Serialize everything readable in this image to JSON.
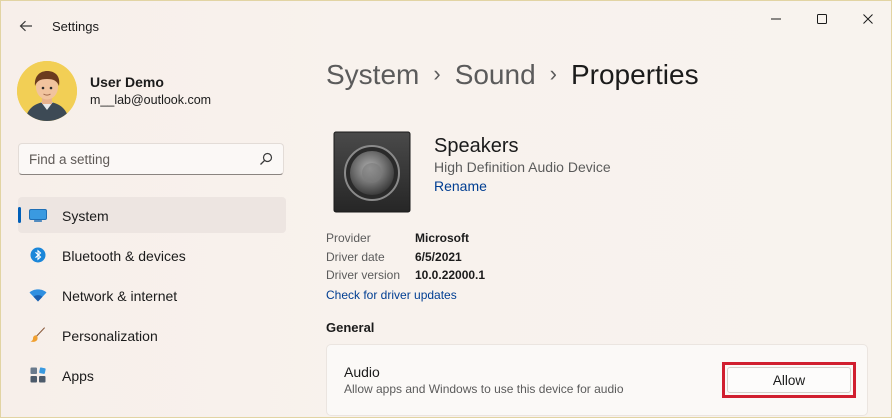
{
  "app": {
    "title": "Settings"
  },
  "user": {
    "name": "User Demo",
    "email": "m__lab@outlook.com"
  },
  "search": {
    "placeholder": "Find a setting",
    "icon": "search-icon"
  },
  "nav": {
    "items": [
      {
        "label": "System",
        "icon": "system-icon",
        "active": true
      },
      {
        "label": "Bluetooth & devices",
        "icon": "bluetooth-icon"
      },
      {
        "label": "Network & internet",
        "icon": "wifi-icon"
      },
      {
        "label": "Personalization",
        "icon": "brush-icon"
      },
      {
        "label": "Apps",
        "icon": "apps-icon"
      }
    ]
  },
  "breadcrumb": {
    "items": [
      "System",
      "Sound",
      "Properties"
    ]
  },
  "device": {
    "name": "Speakers",
    "subtitle": "High Definition Audio Device",
    "rename_label": "Rename",
    "properties": [
      {
        "key": "Provider",
        "value": "Microsoft"
      },
      {
        "key": "Driver date",
        "value": "6/5/2021"
      },
      {
        "key": "Driver version",
        "value": "10.0.22000.1"
      }
    ],
    "driver_link": "Check for driver updates"
  },
  "general": {
    "title": "General",
    "audio": {
      "title": "Audio",
      "description": "Allow apps and Windows to use this device for audio",
      "button_label": "Allow"
    }
  },
  "colors": {
    "accent": "#005fb8",
    "highlight": "#d11f2f",
    "link": "#003e92"
  }
}
